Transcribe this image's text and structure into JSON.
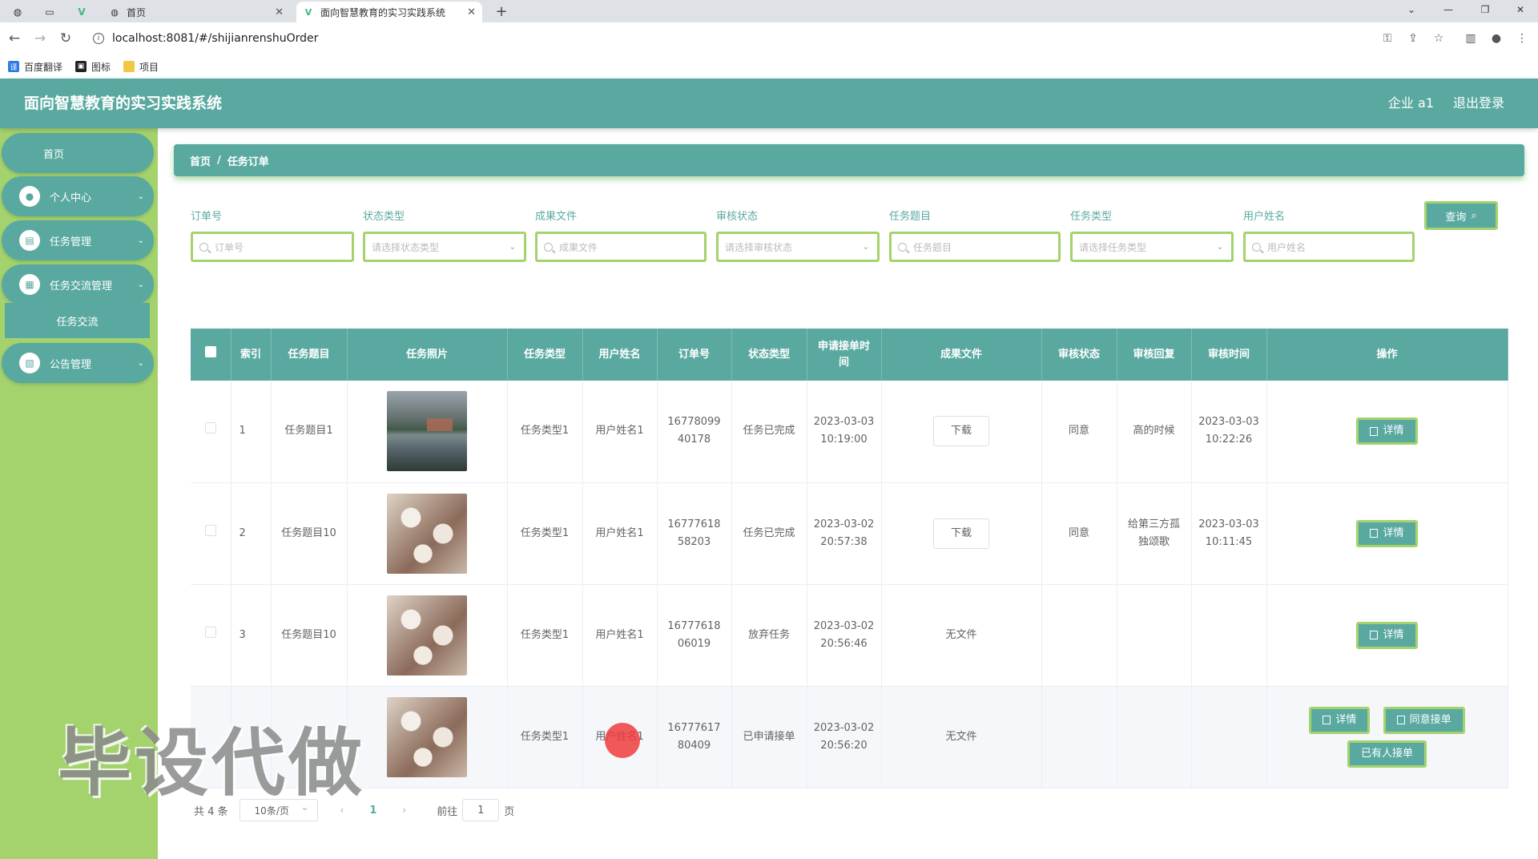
{
  "browser": {
    "tabs": [
      {
        "label": "首页"
      },
      {
        "label": "面向智慧教育的实习实践系统"
      }
    ],
    "url": "localhost:8081/#/shijianrenshuOrder",
    "bookmarks": [
      "百度翻译",
      "图标",
      "项目"
    ]
  },
  "header": {
    "title": "面向智慧教育的实习实践系统",
    "user": "企业 a1",
    "logout": "退出登录"
  },
  "sidebar": {
    "home": "首页",
    "items": [
      {
        "label": "个人中心",
        "icon": "user-icon"
      },
      {
        "label": "任务管理",
        "icon": "briefcase-icon"
      },
      {
        "label": "任务交流管理",
        "icon": "clipboard-icon"
      },
      {
        "label": "公告管理",
        "icon": "notice-icon"
      }
    ],
    "sub_item": "任务交流"
  },
  "breadcrumb": {
    "home": "首页",
    "sep": "/",
    "current": "任务订单"
  },
  "filters": [
    {
      "label": "订单号",
      "placeholder": "订单号",
      "type": "input"
    },
    {
      "label": "状态类型",
      "placeholder": "请选择状态类型",
      "type": "select"
    },
    {
      "label": "成果文件",
      "placeholder": "成果文件",
      "type": "input"
    },
    {
      "label": "审核状态",
      "placeholder": "请选择审核状态",
      "type": "select"
    },
    {
      "label": "任务题目",
      "placeholder": "任务题目",
      "type": "input"
    },
    {
      "label": "任务类型",
      "placeholder": "请选择任务类型",
      "type": "select"
    },
    {
      "label": "用户姓名",
      "placeholder": "用户姓名",
      "type": "input"
    }
  ],
  "query_button": "查询",
  "table": {
    "headers": [
      "",
      "索引",
      "任务题目",
      "任务照片",
      "任务类型",
      "用户姓名",
      "订单号",
      "状态类型",
      "申请接单时间",
      "成果文件",
      "审核状态",
      "审核回复",
      "审核时间",
      "操作"
    ],
    "rows": [
      {
        "index": "1",
        "title": "任务题目1",
        "photo": "lake",
        "type": "任务类型1",
        "user": "用户姓名1",
        "order": "1677809940178",
        "status": "任务已完成",
        "apply_time": "2023-03-03 10:19:00",
        "file": "下载",
        "audit": "同意",
        "reply": "高的时候",
        "audit_time": "2023-03-03 10:22:26",
        "actions": [
          "详情"
        ]
      },
      {
        "index": "2",
        "title": "任务题目10",
        "photo": "blossom",
        "type": "任务类型1",
        "user": "用户姓名1",
        "order": "1677761858203",
        "status": "任务已完成",
        "apply_time": "2023-03-02 20:57:38",
        "file": "下载",
        "audit": "同意",
        "reply": "给第三方孤独颂歌",
        "audit_time": "2023-03-03 10:11:45",
        "actions": [
          "详情"
        ]
      },
      {
        "index": "3",
        "title": "任务题目10",
        "photo": "blossom",
        "type": "任务类型1",
        "user": "用户姓名1",
        "order": "1677761806019",
        "status": "放弃任务",
        "apply_time": "2023-03-02 20:56:46",
        "file": "无文件",
        "audit": "",
        "reply": "",
        "audit_time": "",
        "actions": [
          "详情"
        ]
      },
      {
        "index": "",
        "title": "",
        "photo": "blossom",
        "type": "任务类型1",
        "user": "用户姓名1",
        "order": "1677761780409",
        "status": "已申请接单",
        "apply_time": "2023-03-02 20:56:20",
        "file": "无文件",
        "audit": "",
        "reply": "",
        "audit_time": "",
        "actions": [
          "详情",
          "同意接单",
          "已有人接单"
        ]
      }
    ]
  },
  "pagination": {
    "total": "共 4 条",
    "page_size": "10条/页",
    "current": "1",
    "goto_prefix": "前往",
    "goto_value": "1",
    "goto_suffix": "页"
  },
  "watermark": "毕设代做",
  "colors": {
    "primary": "#5aa9a0",
    "sidebar": "#a4d36e"
  }
}
